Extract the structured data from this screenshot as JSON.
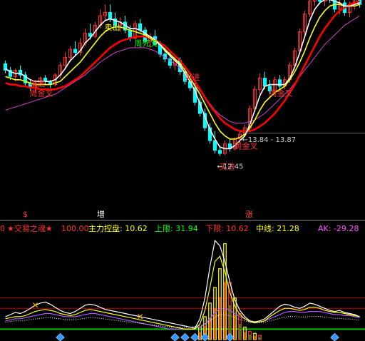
{
  "colors": {
    "background": "#000000",
    "up": "#ff3030",
    "down": "#00ffff",
    "vol_up": "#ff3030",
    "vol_down": "#00c000",
    "ma_white": "#ffffff",
    "ma_yellow": "#ffff00",
    "ma_red": "#ff0000",
    "ma_purple": "#cc44cc",
    "label_red": "#ff3030",
    "label_yellow": "#ffff00",
    "label_green": "#00ff00",
    "label_purple": "#ff55ff",
    "gridline_red": "#c00000",
    "axis_gray": "#888888",
    "diamond": "#3399ff"
  },
  "chart_data": [
    {
      "type": "candlestick",
      "title": "",
      "ylim": [
        9.0,
        22.0
      ],
      "candles": [
        [
          18.2,
          18.4,
          17.6,
          17.8
        ],
        [
          17.8,
          18.0,
          17.2,
          17.4
        ],
        [
          17.4,
          17.9,
          17.1,
          17.8
        ],
        [
          17.8,
          18.1,
          17.3,
          17.5
        ],
        [
          17.5,
          17.7,
          16.8,
          17.0
        ],
        [
          17.0,
          17.2,
          16.5,
          16.7
        ],
        [
          16.7,
          17.1,
          16.4,
          17.0
        ],
        [
          17.0,
          17.4,
          16.8,
          17.3
        ],
        [
          17.3,
          17.5,
          16.9,
          17.1
        ],
        [
          17.1,
          17.2,
          16.7,
          16.9
        ],
        [
          16.9,
          17.6,
          16.8,
          17.5
        ],
        [
          17.5,
          18.3,
          17.3,
          18.1
        ],
        [
          18.1,
          18.9,
          17.9,
          18.6
        ],
        [
          18.6,
          19.3,
          18.3,
          19.1
        ],
        [
          19.1,
          19.6,
          18.7,
          18.9
        ],
        [
          18.9,
          19.8,
          18.7,
          19.5
        ],
        [
          19.5,
          20.4,
          19.3,
          20.1
        ],
        [
          20.1,
          20.7,
          19.7,
          19.9
        ],
        [
          19.9,
          20.8,
          19.8,
          20.6
        ],
        [
          20.6,
          21.6,
          20.4,
          21.2
        ],
        [
          21.2,
          21.9,
          20.9,
          21.4
        ],
        [
          21.4,
          21.9,
          20.8,
          21.0
        ],
        [
          21.0,
          21.4,
          20.4,
          20.6
        ],
        [
          20.6,
          21.1,
          20.2,
          20.8
        ],
        [
          20.8,
          21.2,
          20.1,
          20.3
        ],
        [
          20.3,
          20.6,
          19.6,
          19.8
        ],
        [
          19.8,
          20.9,
          19.7,
          20.7
        ],
        [
          20.7,
          21.0,
          20.1,
          20.3
        ],
        [
          20.3,
          20.5,
          19.5,
          19.6
        ],
        [
          19.6,
          20.1,
          19.2,
          19.9
        ],
        [
          19.9,
          20.3,
          19.3,
          19.4
        ],
        [
          19.4,
          19.6,
          18.6,
          18.8
        ],
        [
          18.8,
          19.2,
          18.3,
          18.5
        ],
        [
          18.5,
          18.9,
          17.9,
          18.1
        ],
        [
          18.1,
          18.6,
          17.8,
          18.4
        ],
        [
          18.4,
          18.6,
          17.5,
          17.7
        ],
        [
          17.7,
          18.0,
          16.9,
          17.1
        ],
        [
          17.1,
          17.5,
          16.5,
          16.7
        ],
        [
          16.7,
          17.0,
          15.6,
          15.8
        ],
        [
          15.8,
          16.1,
          14.9,
          15.1
        ],
        [
          15.1,
          15.4,
          14.0,
          14.2
        ],
        [
          14.2,
          14.5,
          13.2,
          13.4
        ],
        [
          13.4,
          14.0,
          12.6,
          12.8
        ],
        [
          12.8,
          13.1,
          12.45,
          12.6
        ],
        [
          12.6,
          13.4,
          12.5,
          13.2
        ],
        [
          13.2,
          13.5,
          12.7,
          12.9
        ],
        [
          12.9,
          13.6,
          12.8,
          13.5
        ],
        [
          13.5,
          14.0,
          13.2,
          13.8
        ],
        [
          13.8,
          14.4,
          13.6,
          14.2
        ],
        [
          14.2,
          15.6,
          14.0,
          15.4
        ],
        [
          15.4,
          16.8,
          15.2,
          16.6
        ],
        [
          16.6,
          17.6,
          16.3,
          17.3
        ],
        [
          17.3,
          17.7,
          16.6,
          16.8
        ],
        [
          16.8,
          17.2,
          16.3,
          16.5
        ],
        [
          16.5,
          17.4,
          16.3,
          17.2
        ],
        [
          17.2,
          17.5,
          16.6,
          16.8
        ],
        [
          16.8,
          17.4,
          16.6,
          17.2
        ],
        [
          17.2,
          18.3,
          17.0,
          18.1
        ],
        [
          18.1,
          19.2,
          17.9,
          19.0
        ],
        [
          19.0,
          20.4,
          18.8,
          20.2
        ],
        [
          20.2,
          21.5,
          20.0,
          21.3
        ],
        [
          21.3,
          22.4,
          21.1,
          22.1
        ],
        [
          22.1,
          22.6,
          21.8,
          22.3
        ],
        [
          22.3,
          22.8,
          21.9,
          22.1
        ],
        [
          22.1,
          22.9,
          21.8,
          22.5
        ],
        [
          22.5,
          23.0,
          22.0,
          22.2
        ],
        [
          22.2,
          22.6,
          21.4,
          21.6
        ],
        [
          21.6,
          22.2,
          21.3,
          22.0
        ],
        [
          22.0,
          22.4,
          21.2,
          21.4
        ],
        [
          21.4,
          22.1,
          21.1,
          21.9
        ],
        [
          21.9,
          22.5,
          21.6,
          22.3
        ],
        [
          22.3,
          22.7,
          21.7,
          21.9
        ]
      ],
      "ma_white": [
        17.9,
        17.7,
        17.6,
        17.6,
        17.4,
        17.2,
        17.1,
        17.1,
        17.1,
        17.1,
        17.2,
        17.5,
        17.9,
        18.4,
        18.7,
        19.0,
        19.5,
        19.8,
        20.2,
        20.6,
        20.9,
        21.0,
        20.9,
        20.8,
        20.6,
        20.4,
        20.4,
        20.3,
        20.1,
        19.9,
        19.7,
        19.4,
        19.0,
        18.7,
        18.4,
        18.1,
        17.6,
        17.1,
        16.5,
        15.7,
        14.9,
        14.1,
        13.5,
        13.0,
        12.9,
        12.9,
        13.1,
        13.4,
        13.7,
        14.4,
        15.3,
        16.2,
        16.8,
        16.9,
        16.9,
        16.9,
        16.9,
        17.3,
        18.0,
        18.9,
        19.9,
        20.9,
        21.6,
        22.0,
        22.2,
        22.2,
        22.1,
        22.0,
        21.8,
        21.8,
        21.9,
        22.0
      ],
      "ma_yellow": [
        17.4,
        17.3,
        17.2,
        17.2,
        17.1,
        17.0,
        16.9,
        16.9,
        16.9,
        16.9,
        17.0,
        17.1,
        17.4,
        17.7,
        18.0,
        18.3,
        18.7,
        19.1,
        19.5,
        19.9,
        20.2,
        20.4,
        20.5,
        20.5,
        20.4,
        20.3,
        20.2,
        20.1,
        20.0,
        19.8,
        19.6,
        19.4,
        19.1,
        18.8,
        18.5,
        18.2,
        17.8,
        17.3,
        16.8,
        16.3,
        15.7,
        15.1,
        14.5,
        14.0,
        13.7,
        13.5,
        13.5,
        13.6,
        13.8,
        14.2,
        14.7,
        15.3,
        15.8,
        16.1,
        16.4,
        16.6,
        16.8,
        17.2,
        17.7,
        18.3,
        19.0,
        19.8,
        20.5,
        21.1,
        21.5,
        21.8,
        21.9,
        21.9,
        21.8,
        21.8,
        21.8,
        21.9
      ],
      "ma_red": [
        17.0,
        16.9,
        16.9,
        16.8,
        16.8,
        16.7,
        16.7,
        16.6,
        16.6,
        16.6,
        16.6,
        16.7,
        16.8,
        17.0,
        17.2,
        17.4,
        17.7,
        18.0,
        18.3,
        18.6,
        18.9,
        19.2,
        19.4,
        19.6,
        19.7,
        19.8,
        19.9,
        19.9,
        19.9,
        19.8,
        19.7,
        19.5,
        19.3,
        19.0,
        18.7,
        18.4,
        18.0,
        17.6,
        17.1,
        16.6,
        16.1,
        15.6,
        15.2,
        14.8,
        14.5,
        14.3,
        14.1,
        14.0,
        14.0,
        14.0,
        14.1,
        14.3,
        14.5,
        14.8,
        15.1,
        15.5,
        15.9,
        16.4,
        16.9,
        17.5,
        18.1,
        18.7,
        19.3,
        19.9,
        20.4,
        20.8,
        21.2,
        21.5,
        21.7,
        21.9,
        22.0,
        22.1
      ],
      "ma_purple": [
        15.3,
        15.4,
        15.5,
        15.6,
        15.7,
        15.8,
        15.9,
        16.0,
        16.1,
        16.2,
        16.3,
        16.5,
        16.7,
        16.9,
        17.1,
        17.3,
        17.5,
        17.8,
        18.0,
        18.3,
        18.5,
        18.7,
        18.9,
        19.0,
        19.1,
        19.2,
        19.2,
        19.2,
        19.2,
        19.1,
        19.0,
        18.8,
        18.6,
        18.4,
        18.2,
        17.9,
        17.6,
        17.3,
        16.9,
        16.5,
        16.1,
        15.7,
        15.3,
        15.0,
        14.8,
        14.6,
        14.5,
        14.5,
        14.5,
        14.6,
        14.7,
        14.9,
        15.1,
        15.4,
        15.7,
        16.0,
        16.3,
        16.6,
        17.0,
        17.4,
        17.8,
        18.2,
        18.6,
        19.0,
        19.4,
        19.7,
        20.0,
        20.3,
        20.6,
        20.8,
        21.0,
        21.2
      ],
      "annotations": [
        {
          "text": "买进",
          "at_index": 6,
          "value": 16.8,
          "color": "#ff3030"
        },
        {
          "text": "周金叉",
          "at_index": 6,
          "value": 16.2,
          "color": "#ff3030"
        },
        {
          "text": "卖出",
          "at_index": 21,
          "value": 20.3,
          "color": "#ffff00"
        },
        {
          "text": "周死叉",
          "at_index": 27,
          "value": 19.3,
          "color": "#00ff00"
        },
        {
          "text": "买进",
          "at_index": 37,
          "value": 17.2,
          "color": "#ff3030"
        },
        {
          "text": "周金叉",
          "at_index": 47,
          "value": 12.9,
          "color": "#ff3030"
        },
        {
          "text": "买进",
          "at_index": 44,
          "value": 11.6,
          "color": "#ff3030"
        },
        {
          "text": "周金叉",
          "at_index": 54,
          "value": 16.2,
          "color": "#ff3030"
        }
      ],
      "range_label": "13.84 - 13.87",
      "range_label_value": 13.86,
      "range_label_index": 48,
      "low_label": "12.45",
      "low_label_index": 43
    },
    {
      "type": "bar",
      "title": "",
      "indicator_name": "★交易之魂★",
      "indicator_value": "100.00",
      "series_labels": [
        {
          "name": "主力控盘",
          "value": "10.62",
          "color": "#ffff00"
        },
        {
          "name": "上限",
          "value": "31.94",
          "color": "#00ff00"
        },
        {
          "name": "下限",
          "value": "10.62",
          "color": "#ff3030"
        },
        {
          "name": "中线",
          "value": "21.28",
          "color": "#ffff00"
        }
      ],
      "ak_label": "AK: -29.28",
      "ylim": [
        0,
        100
      ],
      "hlines": [
        40,
        30,
        10
      ],
      "volume_bars": [
        [
          0,
          0
        ],
        [
          0,
          0
        ],
        [
          0,
          0
        ],
        [
          0,
          0
        ],
        [
          0,
          0
        ],
        [
          0,
          0
        ],
        [
          0,
          0
        ],
        [
          0,
          0
        ],
        [
          0,
          0
        ],
        [
          0,
          0
        ],
        [
          0,
          0
        ],
        [
          0,
          0
        ],
        [
          0,
          0
        ],
        [
          0,
          0
        ],
        [
          0,
          0
        ],
        [
          0,
          0
        ],
        [
          0,
          0
        ],
        [
          0,
          0
        ],
        [
          0,
          0
        ],
        [
          0,
          0
        ],
        [
          0,
          0
        ],
        [
          0,
          0
        ],
        [
          0,
          0
        ],
        [
          0,
          0
        ],
        [
          0,
          0
        ],
        [
          0,
          0
        ],
        [
          0,
          0
        ],
        [
          0,
          0
        ],
        [
          0,
          0
        ],
        [
          0,
          0
        ],
        [
          0,
          0
        ],
        [
          0,
          0
        ],
        [
          0,
          0
        ],
        [
          0,
          0
        ],
        [
          0,
          0
        ],
        [
          0,
          0
        ],
        [
          0,
          0
        ],
        [
          0,
          0
        ],
        [
          0,
          0
        ],
        [
          12,
          1
        ],
        [
          22,
          1
        ],
        [
          35,
          1
        ],
        [
          50,
          1
        ],
        [
          68,
          1
        ],
        [
          92,
          1
        ],
        [
          55,
          0
        ],
        [
          40,
          1
        ],
        [
          25,
          0
        ],
        [
          12,
          1
        ],
        [
          8,
          0
        ],
        [
          6,
          1
        ],
        [
          4,
          0
        ],
        [
          0,
          0
        ],
        [
          0,
          0
        ],
        [
          0,
          0
        ],
        [
          0,
          0
        ],
        [
          0,
          0
        ],
        [
          0,
          0
        ],
        [
          0,
          0
        ],
        [
          0,
          0
        ],
        [
          0,
          0
        ],
        [
          0,
          0
        ],
        [
          0,
          0
        ],
        [
          0,
          0
        ],
        [
          0,
          0
        ],
        [
          0,
          0
        ],
        [
          0,
          0
        ],
        [
          0,
          0
        ],
        [
          0,
          0
        ],
        [
          0,
          0
        ],
        [
          0,
          0
        ],
        [
          0,
          0
        ]
      ],
      "line_white": [
        22,
        24,
        26,
        25,
        27,
        30,
        33,
        35,
        36,
        34,
        31,
        28,
        26,
        25,
        27,
        30,
        33,
        34,
        33,
        31,
        29,
        28,
        27,
        26,
        25,
        24,
        23,
        22,
        21,
        20,
        19,
        18,
        17,
        16,
        15,
        14,
        13,
        12,
        11,
        20,
        40,
        70,
        95,
        90,
        75,
        55,
        38,
        28,
        22,
        18,
        17,
        18,
        20,
        24,
        28,
        32,
        34,
        33,
        31,
        30,
        32,
        35,
        34,
        32,
        30,
        28,
        27,
        28,
        26,
        25,
        24,
        22
      ],
      "line_yellow": [
        20,
        21,
        22,
        22,
        23,
        25,
        27,
        28,
        29,
        28,
        27,
        25,
        24,
        23,
        24,
        26,
        28,
        29,
        28,
        27,
        26,
        25,
        24,
        23,
        22,
        21,
        20,
        19,
        18,
        17,
        16,
        15,
        14,
        13,
        12,
        11,
        10,
        10,
        10,
        15,
        28,
        50,
        75,
        80,
        65,
        45,
        32,
        24,
        20,
        17,
        16,
        17,
        18,
        22,
        25,
        28,
        30,
        30,
        29,
        28,
        29,
        31,
        31,
        30,
        28,
        27,
        26,
        26,
        25,
        24,
        23,
        22
      ],
      "line_purple": [
        18,
        19,
        20,
        20,
        21,
        22,
        23,
        24,
        25,
        25,
        24,
        23,
        22,
        22,
        22,
        23,
        24,
        25,
        25,
        24,
        23,
        22,
        21,
        20,
        19,
        18,
        17,
        16,
        15,
        14,
        13,
        12,
        11,
        10,
        10,
        10,
        10,
        10,
        11,
        12,
        15,
        20,
        26,
        30,
        30,
        28,
        25,
        22,
        20,
        18,
        17,
        17,
        18,
        20,
        22,
        24,
        26,
        27,
        27,
        26,
        26,
        27,
        27,
        27,
        26,
        25,
        24,
        24,
        23,
        23,
        22,
        21
      ],
      "markers": {
        "flags": [
          6,
          27
        ],
        "diamonds": [
          11,
          34,
          36,
          38,
          40,
          45,
          66
        ]
      }
    }
  ],
  "axis_labels": {
    "a": "$",
    "b": "增",
    "c": "涨"
  },
  "left_stub": "0"
}
